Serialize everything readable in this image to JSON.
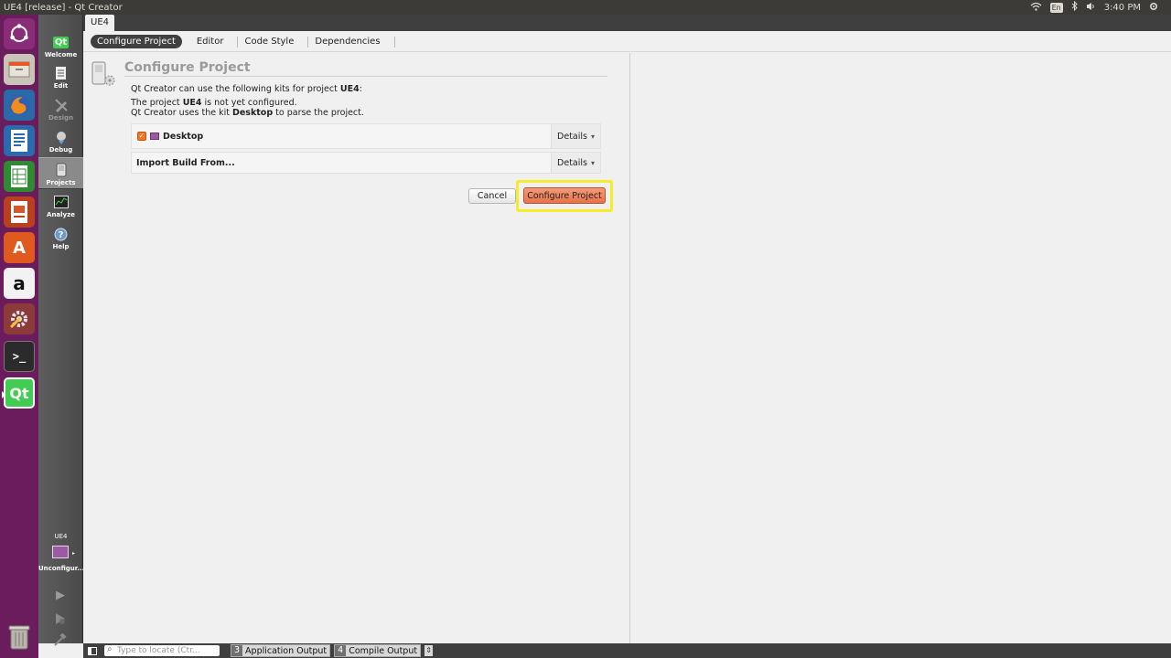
{
  "window": {
    "title": "UE4 [release] - Qt Creator"
  },
  "tray": {
    "keyboard": "En",
    "time": "3:40 PM"
  },
  "launcher": {
    "items": [
      "ubuntu-dash",
      "files",
      "firefox",
      "writer",
      "calc",
      "impress",
      "software-center",
      "amazon",
      "system-settings",
      "terminal",
      "qt-creator"
    ],
    "colors": {
      "bg": "#6a1c5c",
      "accent": "#f47421"
    }
  },
  "modes": {
    "welcome": "Welcome",
    "edit": "Edit",
    "design": "Design",
    "debug": "Debug",
    "projects": "Projects",
    "analyze": "Analyze",
    "help": "Help"
  },
  "project_tab": "UE4",
  "subtabs": [
    "Configure Project",
    "Editor",
    "Code Style",
    "Dependencies"
  ],
  "page": {
    "title": "Configure Project",
    "line1_prefix": "Qt Creator can use the following kits for project ",
    "line1_project": "UE4",
    "line1_suffix": ":",
    "line2_prefix": "The project ",
    "line2_project": "UE4",
    "line2_suffix": " is not yet configured.",
    "line3_prefix": "Qt Creator uses the kit ",
    "line3_kit": "Desktop",
    "line3_suffix": " to parse the project.",
    "kit_name": "Desktop",
    "kit_checked": true,
    "details_label": "Details",
    "import_label": "Import Build From...",
    "cancel_label": "Cancel",
    "configure_label": "Configure Project"
  },
  "target": {
    "project": "UE4",
    "status": "Unconfigur...ed"
  },
  "statusbar": {
    "locate_placeholder": "Type to locate (Ctr...",
    "outputs": [
      {
        "num": "3",
        "label": "Application Output"
      },
      {
        "num": "4",
        "label": "Compile Output"
      }
    ]
  }
}
